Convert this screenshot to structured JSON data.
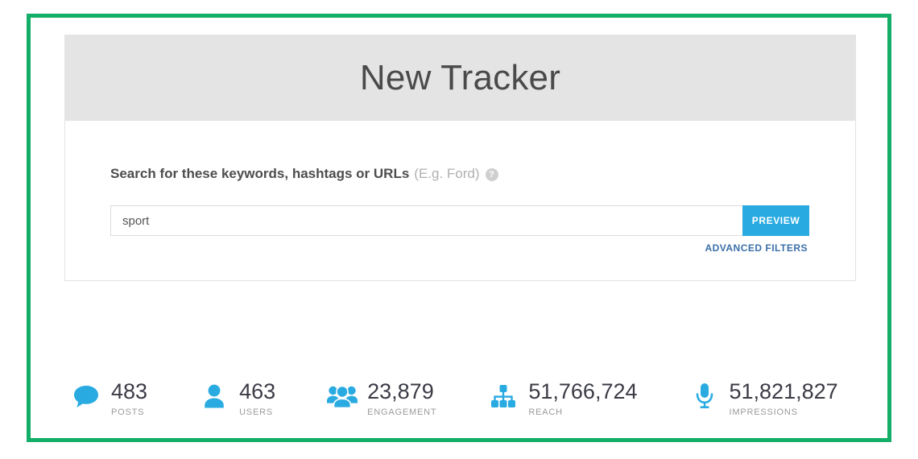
{
  "theme": {
    "frame_color": "#13ae67",
    "accent_blue": "#29abe2",
    "link_blue": "#3a6fa8",
    "header_bg": "#e4e4e4"
  },
  "header": {
    "title": "New Tracker"
  },
  "search": {
    "label": "Search for these keywords, hashtags or URLs",
    "hint": "(E.g. Ford)",
    "help_icon": "help-circle-icon",
    "help_glyph": "?",
    "input_value": "sport",
    "input_placeholder": "",
    "preview_label": "PREVIEW",
    "advanced_filters_label": "ADVANCED FILTERS"
  },
  "stats": [
    {
      "icon": "speech-bubble-icon",
      "value": "483",
      "label": "POSTS"
    },
    {
      "icon": "user-icon",
      "value": "463",
      "label": "USERS"
    },
    {
      "icon": "users-group-icon",
      "value": "23,879",
      "label": "ENGAGEMENT"
    },
    {
      "icon": "sitemap-icon",
      "value": "51,766,724",
      "label": "REACH"
    },
    {
      "icon": "microphone-icon",
      "value": "51,821,827",
      "label": "IMPRESSIONS"
    }
  ]
}
